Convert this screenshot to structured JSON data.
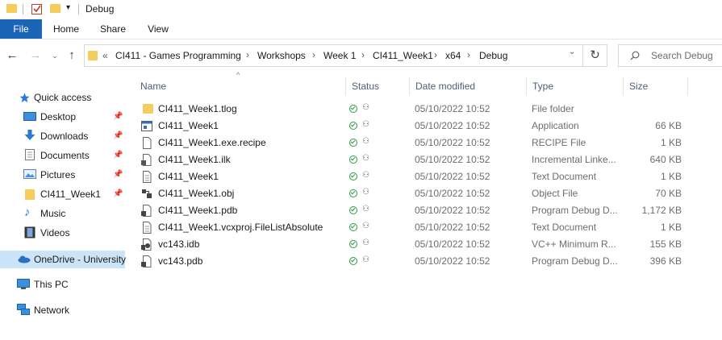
{
  "window": {
    "title": "Debug"
  },
  "ribbon": {
    "tabs": [
      "File",
      "Home",
      "Share",
      "View"
    ]
  },
  "address": {
    "overflow": "«",
    "crumbs": [
      "CI411 - Games Programming",
      "Workshops",
      "Week 1",
      "CI411_Week1",
      "x64",
      "Debug"
    ]
  },
  "search": {
    "placeholder": "Search Debug"
  },
  "nav": {
    "quick_access": "Quick access",
    "items": [
      "Desktop",
      "Downloads",
      "Documents",
      "Pictures",
      "CI411_Week1",
      "Music",
      "Videos"
    ],
    "onedrive": "OneDrive - University",
    "this_pc": "This PC",
    "network": "Network"
  },
  "columns": {
    "name": "Name",
    "status": "Status",
    "date": "Date modified",
    "type": "Type",
    "size": "Size"
  },
  "files": [
    {
      "name": "CI411_Week1.tlog",
      "date": "05/10/2022 10:52",
      "type": "File folder",
      "size": "",
      "icon": "folder-icon"
    },
    {
      "name": "CI411_Week1",
      "date": "05/10/2022 10:52",
      "type": "Application",
      "size": "66 KB",
      "icon": "application-icon"
    },
    {
      "name": "CI411_Week1.exe.recipe",
      "date": "05/10/2022 10:52",
      "type": "RECIPE File",
      "size": "1 KB",
      "icon": "file-icon"
    },
    {
      "name": "CI411_Week1.ilk",
      "date": "05/10/2022 10:52",
      "type": "Incremental Linke...",
      "size": "640 KB",
      "icon": "linker-file-icon"
    },
    {
      "name": "CI411_Week1",
      "date": "05/10/2022 10:52",
      "type": "Text Document",
      "size": "1 KB",
      "icon": "text-document-icon"
    },
    {
      "name": "CI411_Week1.obj",
      "date": "05/10/2022 10:52",
      "type": "Object File",
      "size": "70 KB",
      "icon": "object-file-icon"
    },
    {
      "name": "CI411_Week1.pdb",
      "date": "05/10/2022 10:52",
      "type": "Program Debug D...",
      "size": "1,172 KB",
      "icon": "debug-database-icon"
    },
    {
      "name": "CI411_Week1.vcxproj.FileListAbsolute",
      "date": "05/10/2022 10:52",
      "type": "Text Document",
      "size": "1 KB",
      "icon": "text-document-icon"
    },
    {
      "name": "vc143.idb",
      "date": "05/10/2022 10:52",
      "type": "VC++ Minimum R...",
      "size": "155 KB",
      "icon": "vc-idb-icon"
    },
    {
      "name": "vc143.pdb",
      "date": "05/10/2022 10:52",
      "type": "Program Debug D...",
      "size": "396 KB",
      "icon": "debug-database-icon"
    }
  ],
  "colors": {
    "accent": "#1a65b5",
    "folder": "#f4cd5e",
    "status_ok": "#2e9b41",
    "selected_nav": "#cce4f7"
  }
}
